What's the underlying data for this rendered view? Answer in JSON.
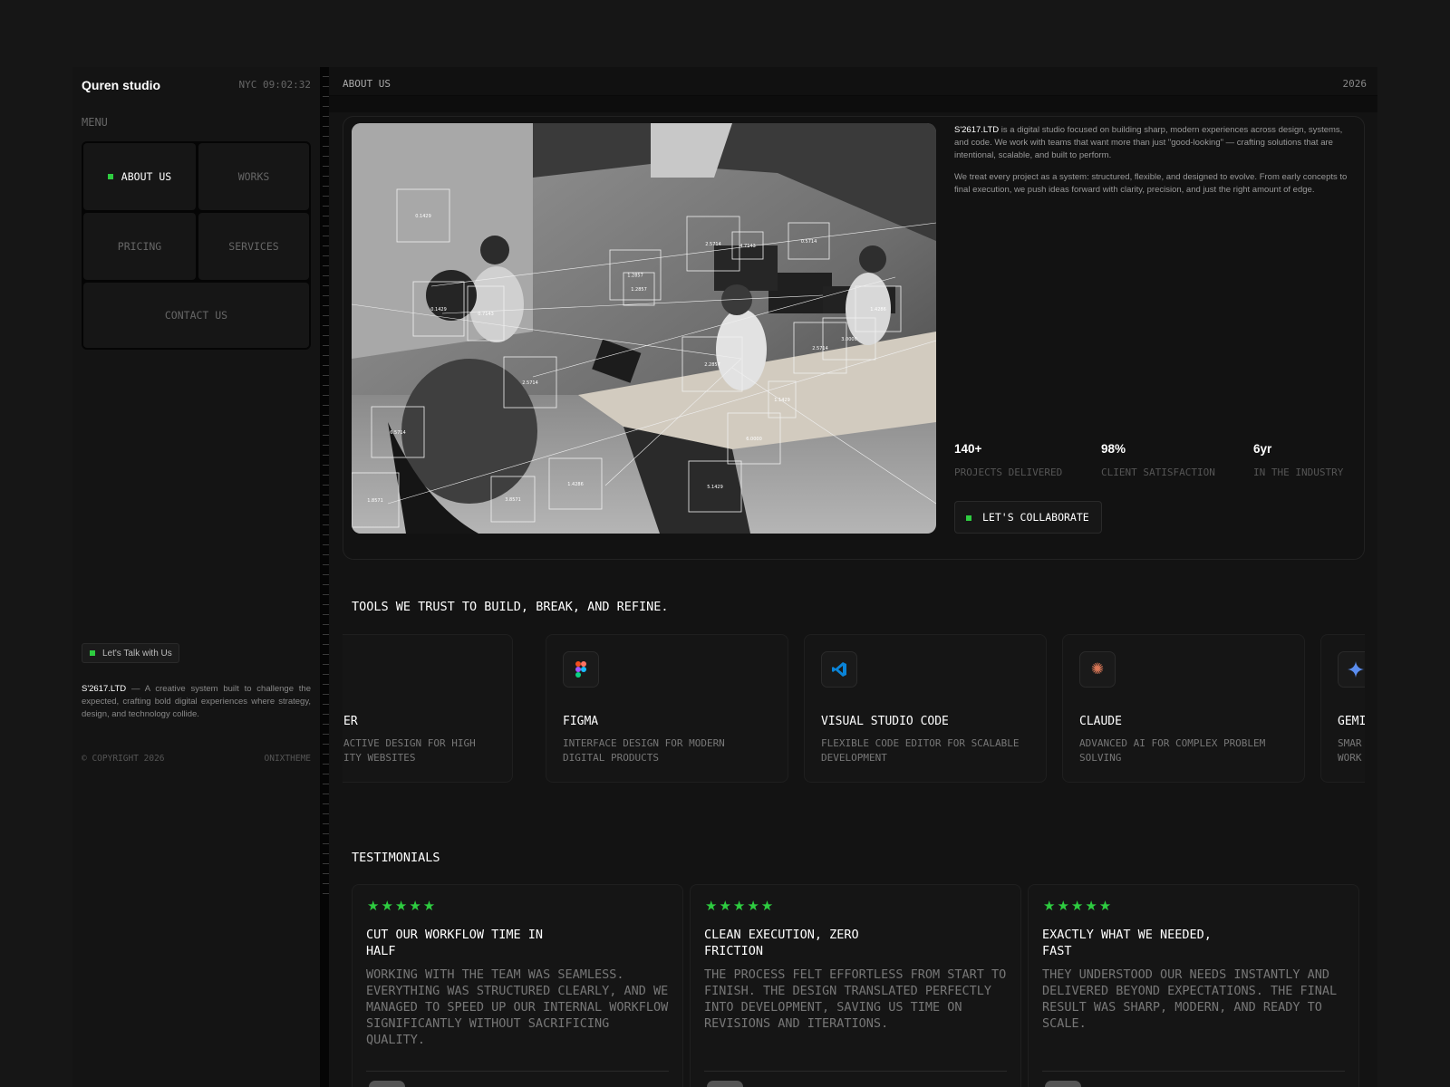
{
  "sidebar": {
    "brand": "Quren studio",
    "clock": "NYC 09:02:32",
    "menu_label": "MENU",
    "menu": [
      {
        "label": "ABOUT US",
        "active": true
      },
      {
        "label": "WORKS",
        "active": false
      },
      {
        "label": "PRICING",
        "active": false
      },
      {
        "label": "SERVICES",
        "active": false
      },
      {
        "label": "CONTACT US",
        "active": false
      }
    ],
    "talk_button": "Let's Talk with Us",
    "blurb_brand": "S'2617.LTD",
    "blurb_text": " — A creative system built to challenge the expected, crafting bold digital experiences where strategy, design, and technology collide.",
    "copyright": "© COPYRIGHT 2026",
    "credit": "ONIXTHEME"
  },
  "header": {
    "breadcrumb": "ABOUT US",
    "year": "2026"
  },
  "about": {
    "brand": "S'2617.LTD",
    "paragraph1": " is a digital studio focused on building sharp, modern experiences across design, systems, and code. We work with teams that want more than just \"good-looking\" — crafting solutions that are intentional, scalable, and built to perform.",
    "paragraph2": "We treat every project as a system: structured, flexible, and designed to evolve. From early concepts to final execution, we push ideas forward with clarity, precision, and just the right amount of edge.",
    "stats": [
      {
        "value": "140+",
        "label": "PROJECTS DELIVERED"
      },
      {
        "value": "98%",
        "label": "CLIENT SATISFACTION"
      },
      {
        "value": "6yr",
        "label": "IN THE INDUSTRY"
      }
    ],
    "cta": "LET'S COLLABORATE",
    "image_labels": [
      "0.1429",
      "0.5714",
      "1.2857",
      "2.5714",
      "0.1429",
      "2.5714",
      "1.4286",
      "2.5714",
      "4.7143",
      "1.2857",
      "6.5714",
      "5.1429",
      "3.8571",
      "1.4286",
      "6.0000",
      "2.2857",
      "1.8571",
      "0.7143",
      "3.0000",
      "1.1429"
    ]
  },
  "tools": {
    "title": "TOOLS WE TRUST TO BUILD, BREAK, AND REFINE.",
    "items": [
      {
        "name": "ER",
        "desc": "ACTIVE DESIGN FOR HIGH ITY WEBSITES",
        "icon": "framer-icon"
      },
      {
        "name": "FIGMA",
        "desc": "INTERFACE DESIGN FOR MODERN DIGITAL PRODUCTS",
        "icon": "figma-icon"
      },
      {
        "name": "VISUAL STUDIO CODE",
        "desc": "FLEXIBLE CODE EDITOR FOR SCALABLE DEVELOPMENT",
        "icon": "vscode-icon"
      },
      {
        "name": "CLAUDE",
        "desc": "ADVANCED AI FOR COMPLEX PROBLEM SOLVING",
        "icon": "claude-icon"
      },
      {
        "name": "GEMI",
        "desc": "SMAR WORK",
        "icon": "gemini-icon"
      }
    ]
  },
  "testimonials": {
    "title": "TESTIMONIALS",
    "rating": "★★★★★",
    "items": [
      {
        "heading": "CUT OUR WORKFLOW TIME IN HALF",
        "body": "WORKING WITH THE TEAM WAS SEAMLESS. EVERYTHING WAS STRUCTURED CLEARLY, AND WE MANAGED TO SPEED UP OUR INTERNAL WORKFLOW SIGNIFICANTLY WITHOUT SACRIFICING QUALITY."
      },
      {
        "heading": "CLEAN EXECUTION, ZERO FRICTION",
        "body": "THE PROCESS FELT EFFORTLESS FROM START TO FINISH. THE DESIGN TRANSLATED PERFECTLY INTO DEVELOPMENT, SAVING US TIME ON REVISIONS AND ITERATIONS."
      },
      {
        "heading": "EXACTLY WHAT WE NEEDED, FAST",
        "body": "THEY UNDERSTOOD OUR NEEDS INSTANTLY AND DELIVERED BEYOND EXPECTATIONS. THE FINAL RESULT WAS SHARP, MODERN, AND READY TO SCALE."
      }
    ]
  },
  "colors": {
    "accent": "#2ecc40",
    "background": "#161616"
  }
}
